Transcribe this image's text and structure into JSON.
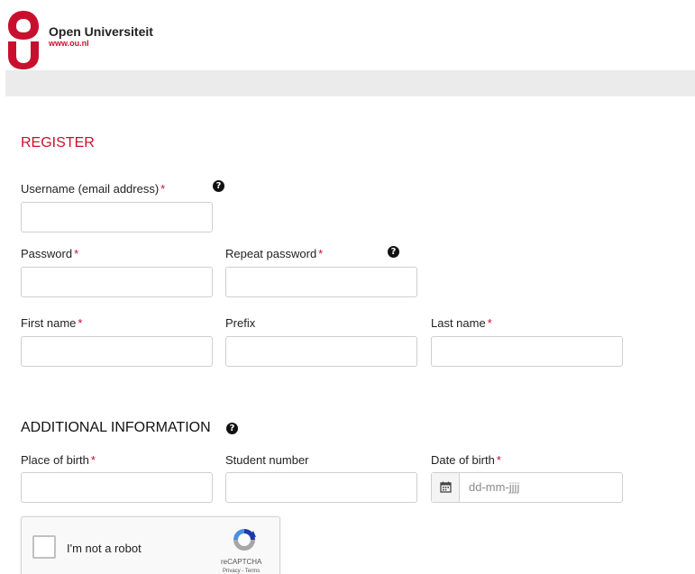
{
  "header": {
    "brand_name": "Open Universiteit",
    "brand_url": "www.ou.nl",
    "brand_color": "#c8102e"
  },
  "register": {
    "title": "REGISTER",
    "username_label": "Username (email address)",
    "password_label": "Password",
    "repeat_password_label": "Repeat password",
    "first_name_label": "First name",
    "prefix_label": "Prefix",
    "last_name_label": "Last name",
    "required_mark": "*"
  },
  "additional": {
    "title": "ADDITIONAL INFORMATION",
    "place_of_birth_label": "Place of birth",
    "student_number_label": "Student number",
    "date_of_birth_label": "Date of birth",
    "date_placeholder": "dd-mm-jjjj"
  },
  "captcha": {
    "label": "I'm not a robot",
    "brand": "reCAPTCHA",
    "links": "Privacy - Terms"
  },
  "icons": {
    "help": "question-circle-icon",
    "calendar": "calendar-icon",
    "logo": "open-universiteit-logo",
    "recaptcha": "recaptcha-logo"
  }
}
